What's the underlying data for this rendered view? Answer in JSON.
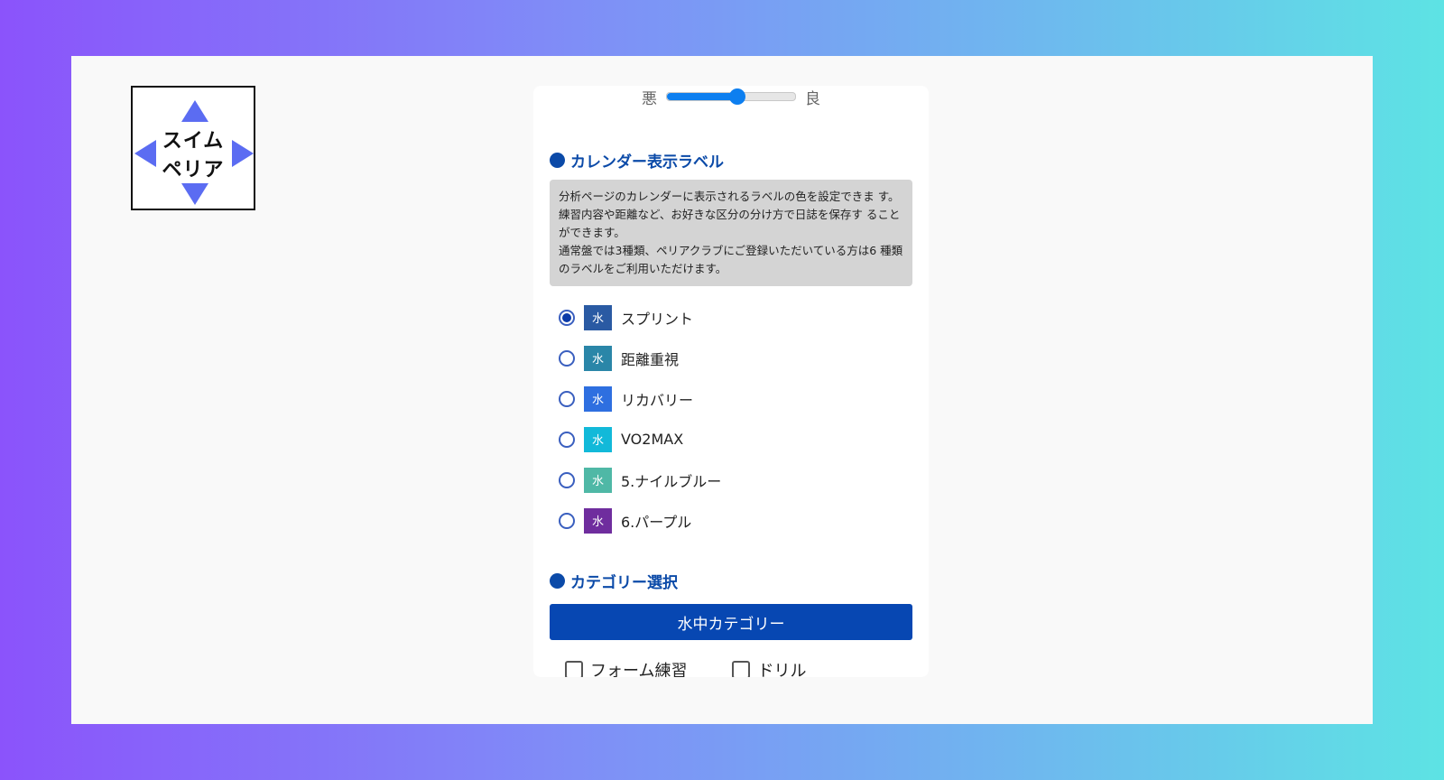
{
  "logo": {
    "line1": "スイム",
    "line2": "ペリア"
  },
  "slider": {
    "min_label": "悪",
    "max_label": "良",
    "value_fraction": 0.55
  },
  "calendar_label": {
    "title": "カレンダー表示ラベル",
    "note_lines": [
      "分析ページのカレンダーに表示されるラベルの色を設定できま す。練習内容や距離など、お好きな区分の分け方で日誌を保存す ることができます。",
      "通常盤では3種類、ペリアクラブにご登録いただいている方は6 種類のラベルをご利用いただけます。"
    ],
    "swatch_text": "水",
    "options": [
      {
        "label": "スプリント",
        "color": "#2a5aa3",
        "checked": true
      },
      {
        "label": "距離重視",
        "color": "#2a86a8",
        "checked": false
      },
      {
        "label": "リカバリー",
        "color": "#2e6fe0",
        "checked": false
      },
      {
        "label": "VO2MAX",
        "color": "#12b9d9",
        "checked": false
      },
      {
        "label": "5.ナイルブルー",
        "color": "#4fb8a6",
        "checked": false
      },
      {
        "label": "6.パープル",
        "color": "#6f2d9e",
        "checked": false
      }
    ]
  },
  "category": {
    "title": "カテゴリー選択",
    "button_label": "水中カテゴリー",
    "checkboxes": [
      {
        "label": "フォーム練習",
        "checked": false
      },
      {
        "label": "ドリル",
        "checked": false
      }
    ]
  },
  "colors": {
    "accent": "#0b4aa8",
    "button": "#0747b2"
  }
}
